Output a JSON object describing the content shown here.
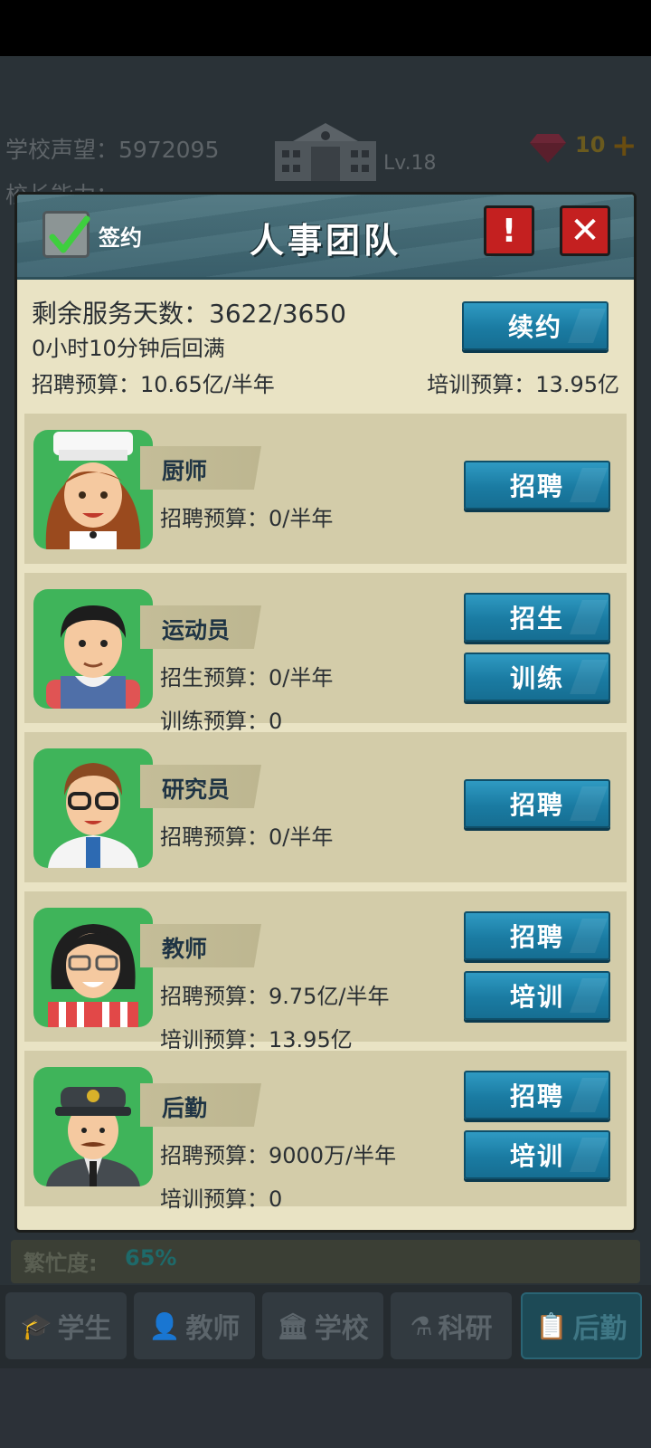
{
  "hud": {
    "reputation_label": "学校声望：",
    "reputation_value": "5972095",
    "second_line_label": "校长能力：",
    "level": "Lv.18",
    "gems": "10",
    "plus": "+"
  },
  "dialog": {
    "sign_label": "签约",
    "title": "人事团队",
    "alert": "!",
    "close": "✕",
    "remaining_label": "剩余服务天数：",
    "remaining_value": "3622/3650",
    "refill_text": "0小时10分钟后回满",
    "renew_button": "续约",
    "recruit_budget_label": "招聘预算：",
    "recruit_budget_value": "10.65亿/半年",
    "training_budget_label": "培训预算：",
    "training_budget_value": "13.95亿"
  },
  "staff": [
    {
      "name": "厨师",
      "line1_label": "招聘预算：",
      "line1_value": "0/半年",
      "btn1": "招聘"
    },
    {
      "name": "运动员",
      "line1_label": "招生预算：",
      "line1_value": "0/半年",
      "line2_label": "训练预算：",
      "line2_value": "0",
      "btn1": "招生",
      "btn2": "训练"
    },
    {
      "name": "研究员",
      "line1_label": "招聘预算：",
      "line1_value": "0/半年",
      "btn1": "招聘"
    },
    {
      "name": "教师",
      "line1_label": "招聘预算：",
      "line1_value": "9.75亿/半年",
      "line2_label": "培训预算：",
      "line2_value": "13.95亿",
      "btn1": "招聘",
      "btn2": "培训"
    },
    {
      "name": "后勤",
      "line1_label": "招聘预算：",
      "line1_value": "9000万/半年",
      "line2_label": "培训预算：",
      "line2_value": "0",
      "btn1": "招聘",
      "btn2": "培训"
    }
  ],
  "prosperity": {
    "label": "繁忙度:",
    "value": "65%"
  },
  "tabs": [
    {
      "label": "学生",
      "icon": "student-icon"
    },
    {
      "label": "教师",
      "icon": "teacher-icon"
    },
    {
      "label": "学校",
      "icon": "school-icon"
    },
    {
      "label": "科研",
      "icon": "flask-icon"
    },
    {
      "label": "后勤",
      "icon": "clipboard-icon",
      "active": true
    }
  ],
  "colors": {
    "dialog_bg": "#e9e3c4",
    "card_bg": "#d3cca9",
    "header_teal": "#4e7680",
    "button_blue": "#1a7ba2",
    "close_red": "#c42020",
    "avatar_green": "#3fb45a"
  }
}
